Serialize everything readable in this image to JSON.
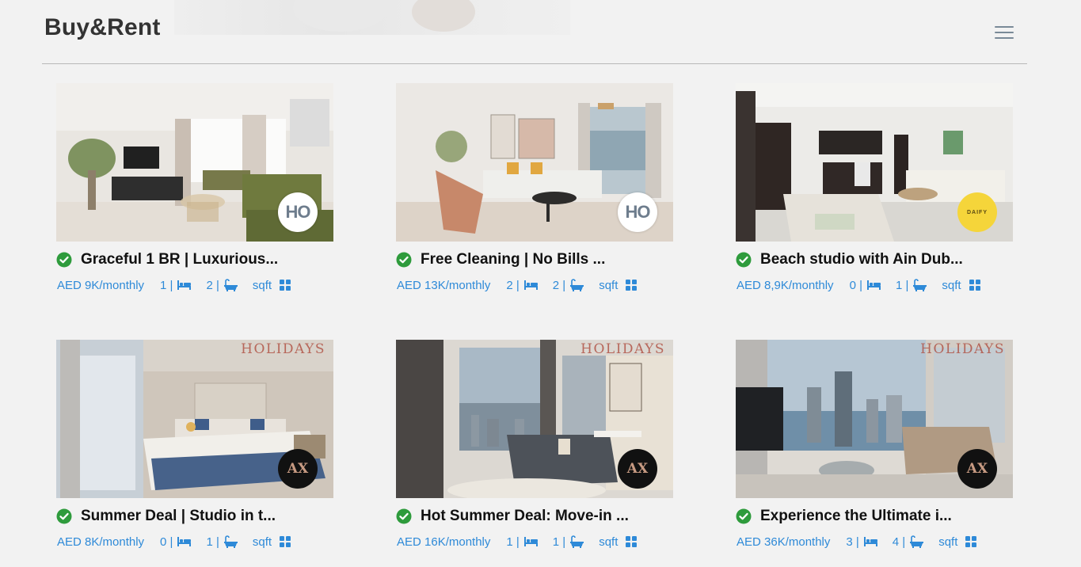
{
  "header": {
    "logo": "Buy&Rent",
    "menu_icon": "hamburger-menu-icon"
  },
  "colors": {
    "accent": "#2e8ad8",
    "verified": "#2e9b3c",
    "title": "#111111",
    "background": "#f2f2f2"
  },
  "listings": [
    {
      "title": "Graceful 1 BR | Luxurious...",
      "price": "AED 9K/monthly",
      "bedrooms": "1 |",
      "bathrooms": "2 |",
      "area_unit": "sqft",
      "agency_badge": "HO",
      "watermark": ""
    },
    {
      "title": "Free Cleaning | No Bills ...",
      "price": "AED 13K/monthly",
      "bedrooms": "2 |",
      "bathrooms": "2 |",
      "area_unit": "sqft",
      "agency_badge": "HO",
      "watermark": ""
    },
    {
      "title": "Beach studio with Ain Dub...",
      "price": "AED 8,9K/monthly",
      "bedrooms": "0 |",
      "bathrooms": "1 |",
      "area_unit": "sqft",
      "agency_badge": "DAIFY",
      "watermark": ""
    },
    {
      "title": "Summer Deal | Studio in t...",
      "price": "AED 8K/monthly",
      "bedrooms": "0 |",
      "bathrooms": "1 |",
      "area_unit": "sqft",
      "agency_badge": "AX",
      "watermark": "HOLIDAYS"
    },
    {
      "title": "Hot Summer Deal: Move-in ...",
      "price": "AED 16K/monthly",
      "bedrooms": "1 |",
      "bathrooms": "1 |",
      "area_unit": "sqft",
      "agency_badge": "AX",
      "watermark": "HOLIDAYS"
    },
    {
      "title": "Experience the Ultimate i...",
      "price": "AED 36K/monthly",
      "bedrooms": "3 |",
      "bathrooms": "4 |",
      "area_unit": "sqft",
      "agency_badge": "AX",
      "watermark": "HOLIDAYS"
    }
  ]
}
